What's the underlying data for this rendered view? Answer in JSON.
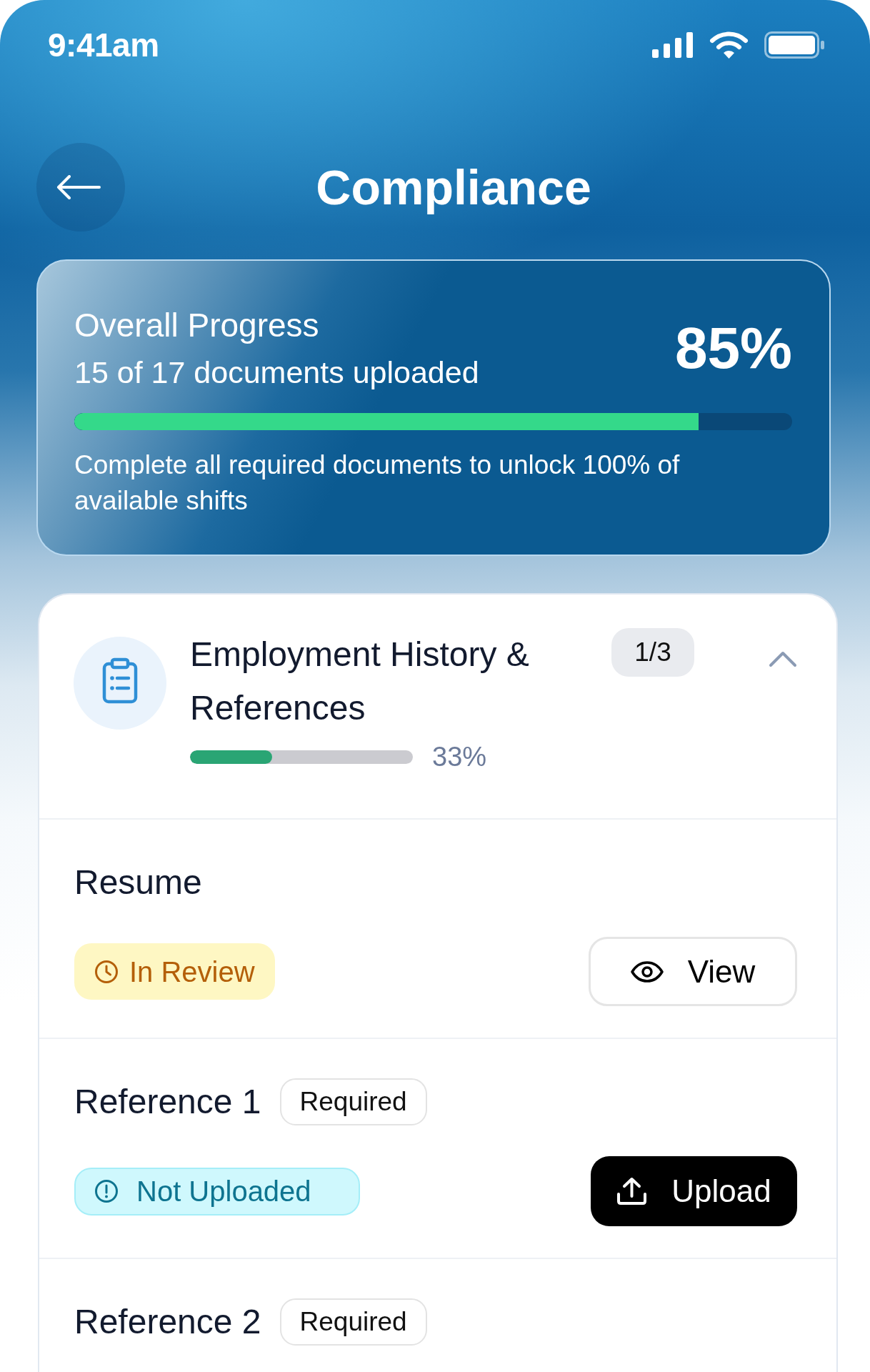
{
  "status_bar": {
    "time": "9:41am"
  },
  "header": {
    "title": "Compliance"
  },
  "overall_progress": {
    "title": "Overall Progress",
    "subtitle": "15 of 17 documents uploaded",
    "percent": "85%",
    "level": 0.87,
    "note": "Complete all required documents to unlock 100% of available shifts"
  },
  "section": {
    "title": "Employment History & References",
    "count": "1/3",
    "expanded": true,
    "level": 0.37,
    "percent": "33%",
    "documents": [
      {
        "name": "Resume",
        "status": {
          "kind": "in_review",
          "label": "In Review"
        },
        "action": {
          "kind": "view",
          "label": "View"
        }
      },
      {
        "name": "Reference 1",
        "tag": "Required",
        "status": {
          "kind": "not_uploaded",
          "label": "Not Uploaded"
        },
        "action": {
          "kind": "upload",
          "label": "Upload"
        }
      },
      {
        "name": "Reference 2",
        "tag": "Required"
      }
    ]
  }
}
